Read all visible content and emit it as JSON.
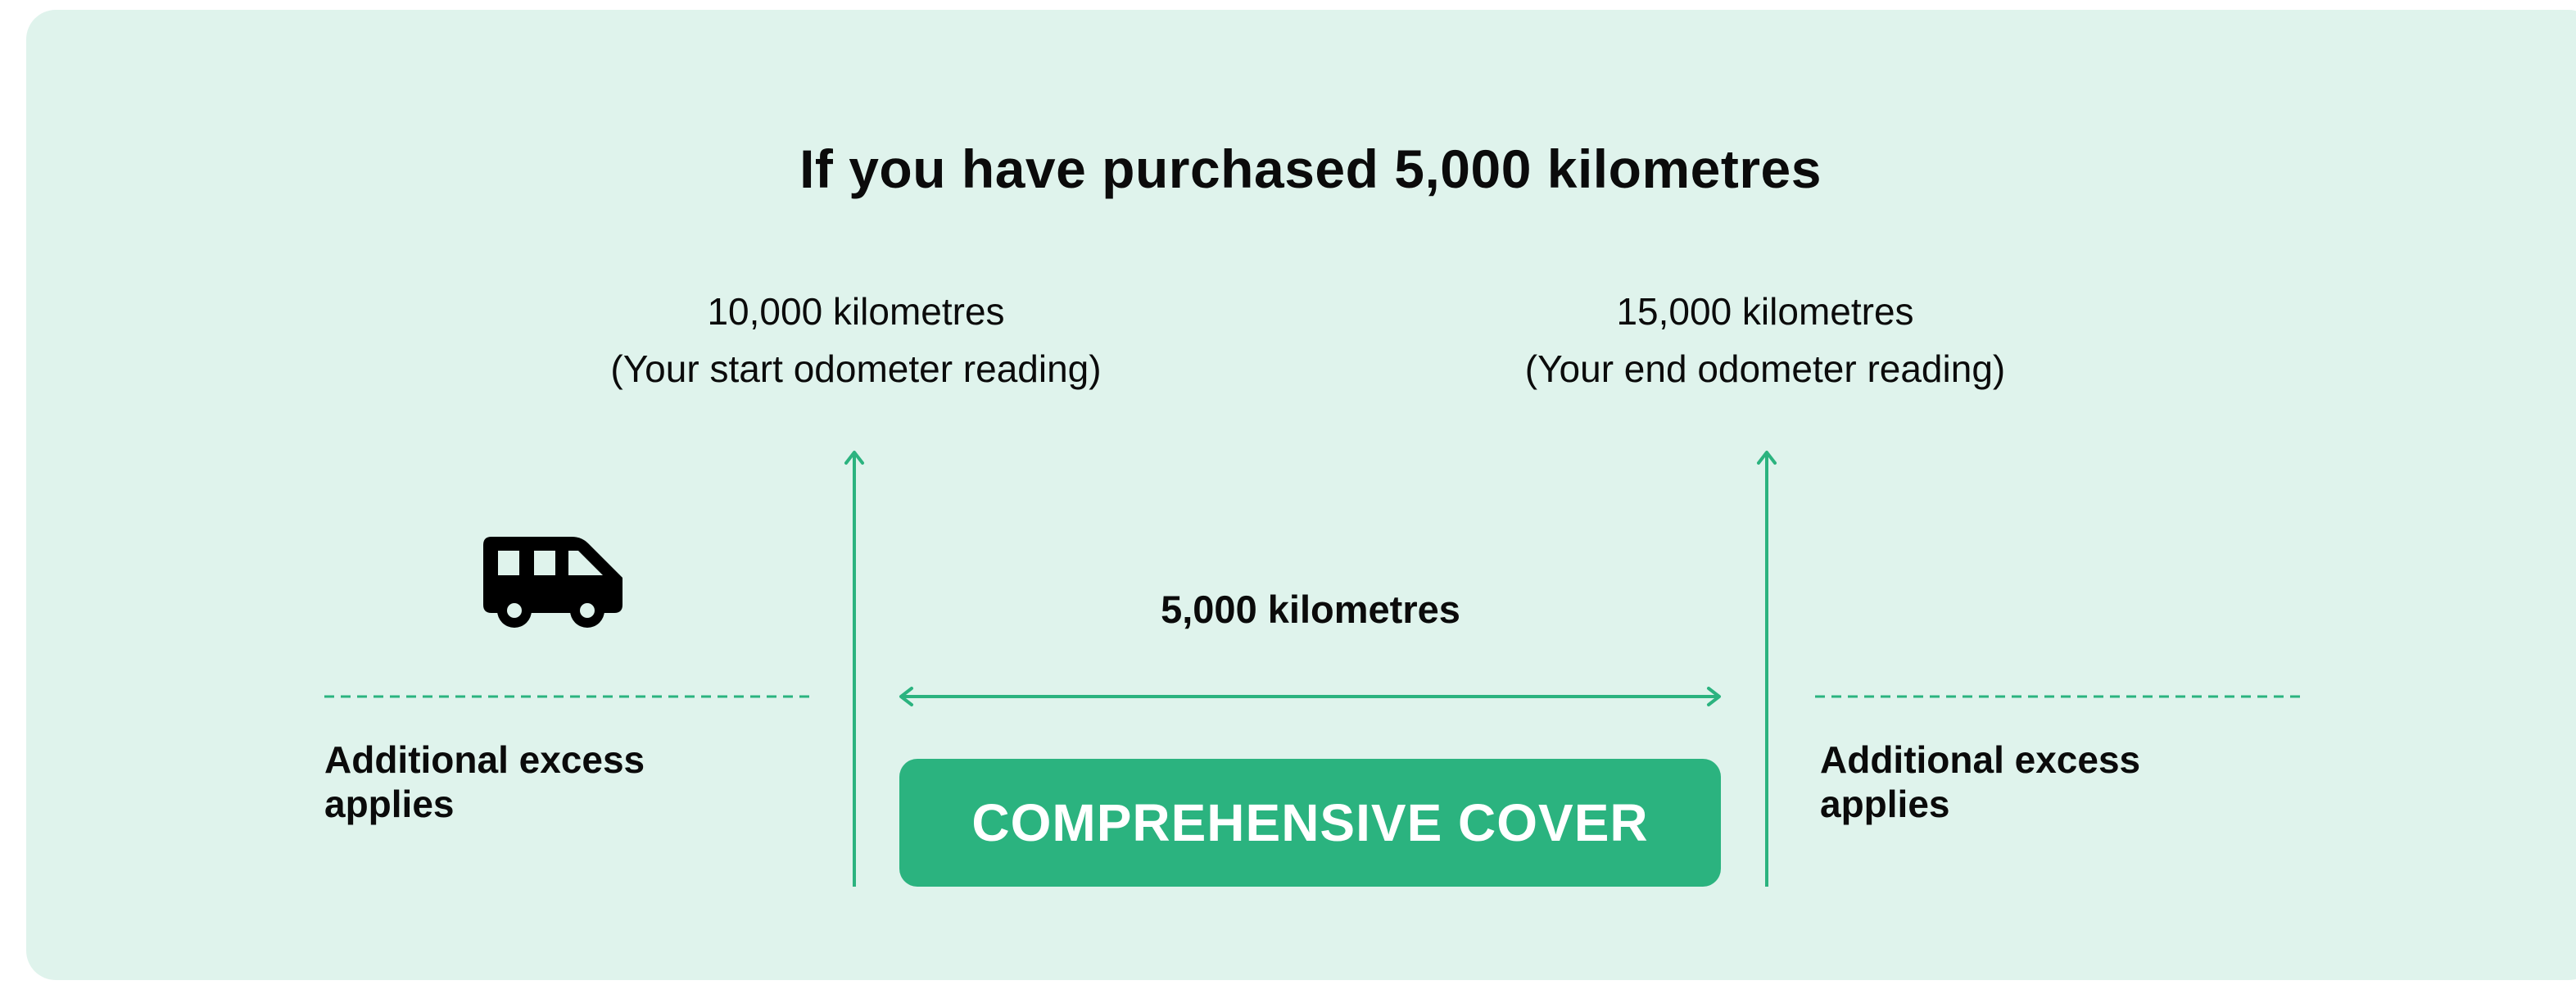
{
  "heading": "If you have purchased 5,000 kilometres",
  "start_reading": {
    "value": "10,000 kilometres",
    "label": "(Your start odometer reading)"
  },
  "end_reading": {
    "value": "15,000 kilometres",
    "label": "(Your end odometer reading)"
  },
  "covered_distance": "5,000 kilometres",
  "excess_left": {
    "line1": "Additional excess",
    "line2": "applies"
  },
  "excess_right": {
    "line1": "Additional excess",
    "line2": "applies"
  },
  "cover_label": "COMPREHENSIVE COVER",
  "icons": {
    "vehicle": "campervan-icon"
  },
  "colors": {
    "panel_bg": "#dff3ec",
    "accent": "#2bb37f",
    "text": "#0b0b0b"
  }
}
